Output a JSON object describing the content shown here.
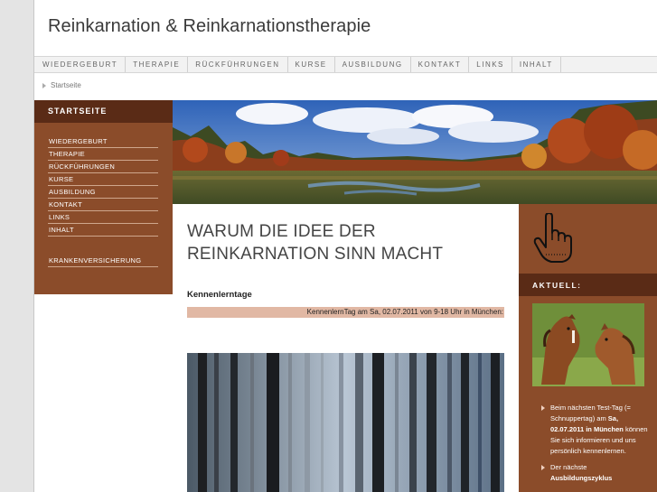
{
  "site": {
    "title": "Reinkarnation & Reinkarnationstherapie"
  },
  "topnav": {
    "items": [
      {
        "label": "WIEDERGEBURT"
      },
      {
        "label": "THERAPIE"
      },
      {
        "label": "RÜCKFÜHRUNGEN"
      },
      {
        "label": "KURSE"
      },
      {
        "label": "AUSBILDUNG"
      },
      {
        "label": "KONTAKT"
      },
      {
        "label": "LINKS"
      },
      {
        "label": "INHALT"
      }
    ]
  },
  "breadcrumb": {
    "current": "Startseite"
  },
  "sidebar": {
    "heading": "STARTSEITE",
    "items": [
      {
        "label": "WIEDERGEBURT"
      },
      {
        "label": "THERAPIE"
      },
      {
        "label": "RÜCKFÜHRUNGEN"
      },
      {
        "label": "KURSE"
      },
      {
        "label": "AUSBILDUNG"
      },
      {
        "label": "KONTAKT"
      },
      {
        "label": "LINKS"
      },
      {
        "label": "INHALT"
      }
    ],
    "extra_item": "KRANKENVERSICHERUNG"
  },
  "main": {
    "headline_line1": "WARUM DIE IDEE DER",
    "headline_line2": "REINKARNATION SINN MACHT",
    "subheading": "Kennenlerntage",
    "ticker": "KennenlernTag am Sa, 02.07.2011 von 9-18 Uhr in München:"
  },
  "right": {
    "icon": "pointing-hand-icon",
    "aktuell_heading": "AKTUELL:",
    "news": [
      {
        "pre": "Beim nächsten Test-Tag (= Schnuppertag) am ",
        "bold": "Sa, 02.07.2011 in München",
        "post": " können Sie sich informieren und uns persönlich kennenlernen."
      },
      {
        "pre": "Der nächste ",
        "bold": "Ausbildungszyklus",
        "post": ""
      }
    ]
  },
  "colors": {
    "brown": "#8b4c2a",
    "dark_brown": "#5a2b16",
    "ticker": "#e1b8a4"
  }
}
